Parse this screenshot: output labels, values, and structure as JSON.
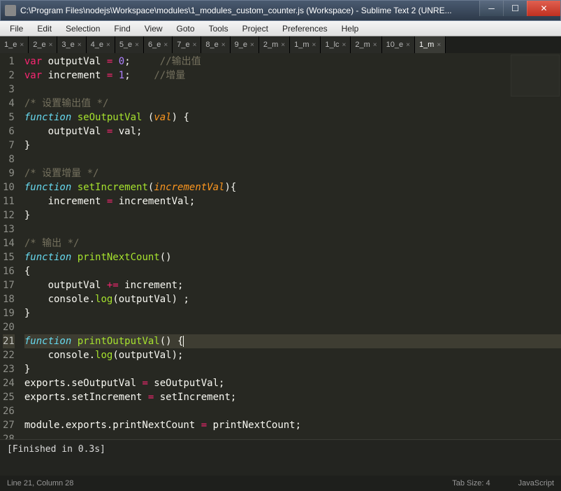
{
  "window": {
    "title": "C:\\Program Files\\nodejs\\Workspace\\modules\\1_modules_custom_counter.js (Workspace) - Sublime Text 2 (UNRE..."
  },
  "menu": [
    "File",
    "Edit",
    "Selection",
    "Find",
    "View",
    "Goto",
    "Tools",
    "Project",
    "Preferences",
    "Help"
  ],
  "tabs": [
    {
      "label": "1_e",
      "active": false
    },
    {
      "label": "2_e",
      "active": false
    },
    {
      "label": "3_e",
      "active": false
    },
    {
      "label": "4_e",
      "active": false
    },
    {
      "label": "5_e",
      "active": false
    },
    {
      "label": "6_e",
      "active": false
    },
    {
      "label": "7_e",
      "active": false
    },
    {
      "label": "8_e",
      "active": false
    },
    {
      "label": "9_e",
      "active": false
    },
    {
      "label": "2_m",
      "active": false
    },
    {
      "label": "1_m",
      "active": false
    },
    {
      "label": "1_lc",
      "active": false
    },
    {
      "label": "2_m",
      "active": false
    },
    {
      "label": "10_e",
      "active": false
    },
    {
      "label": "1_m",
      "active": true
    }
  ],
  "code": [
    {
      "n": 1,
      "tokens": [
        [
          "stor",
          "var"
        ],
        [
          "",
          " "
        ],
        [
          "",
          "outputVal "
        ],
        [
          "op",
          "="
        ],
        [
          "",
          " "
        ],
        [
          "num",
          "0"
        ],
        [
          "",
          ";     "
        ],
        [
          "cmnt",
          "//输出值"
        ]
      ]
    },
    {
      "n": 2,
      "tokens": [
        [
          "stor",
          "var"
        ],
        [
          "",
          " "
        ],
        [
          "",
          "increment "
        ],
        [
          "op",
          "="
        ],
        [
          "",
          " "
        ],
        [
          "num",
          "1"
        ],
        [
          "",
          ";    "
        ],
        [
          "cmnt",
          "//增量"
        ]
      ]
    },
    {
      "n": 3,
      "tokens": []
    },
    {
      "n": 4,
      "tokens": [
        [
          "cmnt",
          "/* 设置输出值 */"
        ]
      ]
    },
    {
      "n": 5,
      "tokens": [
        [
          "kw",
          "function"
        ],
        [
          "",
          " "
        ],
        [
          "name",
          "seOutputVal"
        ],
        [
          "",
          " ("
        ],
        [
          "param",
          "val"
        ],
        [
          "",
          ") {"
        ]
      ]
    },
    {
      "n": 6,
      "tokens": [
        [
          "",
          "    outputVal "
        ],
        [
          "op",
          "="
        ],
        [
          "",
          " val;"
        ]
      ]
    },
    {
      "n": 7,
      "tokens": [
        [
          "",
          "}"
        ]
      ]
    },
    {
      "n": 8,
      "tokens": []
    },
    {
      "n": 9,
      "tokens": [
        [
          "cmnt",
          "/* 设置增量 */"
        ]
      ]
    },
    {
      "n": 10,
      "tokens": [
        [
          "kw",
          "function"
        ],
        [
          "",
          " "
        ],
        [
          "name",
          "setIncrement"
        ],
        [
          "",
          "("
        ],
        [
          "param",
          "incrementVal"
        ],
        [
          "",
          "){"
        ]
      ]
    },
    {
      "n": 11,
      "tokens": [
        [
          "",
          "    increment "
        ],
        [
          "op",
          "="
        ],
        [
          "",
          " incrementVal;"
        ]
      ]
    },
    {
      "n": 12,
      "tokens": [
        [
          "",
          "}"
        ]
      ]
    },
    {
      "n": 13,
      "tokens": []
    },
    {
      "n": 14,
      "tokens": [
        [
          "cmnt",
          "/* 输出 */"
        ]
      ]
    },
    {
      "n": 15,
      "tokens": [
        [
          "kw",
          "function"
        ],
        [
          "",
          " "
        ],
        [
          "name",
          "printNextCount"
        ],
        [
          "",
          "()"
        ]
      ]
    },
    {
      "n": 16,
      "tokens": [
        [
          "",
          "{"
        ]
      ]
    },
    {
      "n": 17,
      "tokens": [
        [
          "",
          "    outputVal "
        ],
        [
          "op",
          "+="
        ],
        [
          "",
          " increment;"
        ]
      ]
    },
    {
      "n": 18,
      "tokens": [
        [
          "",
          "    console."
        ],
        [
          "name",
          "log"
        ],
        [
          "",
          "(outputVal) ;"
        ]
      ]
    },
    {
      "n": 19,
      "tokens": [
        [
          "",
          "}"
        ]
      ]
    },
    {
      "n": 20,
      "tokens": []
    },
    {
      "n": 21,
      "tokens": [
        [
          "kw",
          "function"
        ],
        [
          "",
          " "
        ],
        [
          "name",
          "printOutputVal"
        ],
        [
          "",
          "() {"
        ],
        [
          "cursor",
          ""
        ]
      ],
      "current": true
    },
    {
      "n": 22,
      "tokens": [
        [
          "",
          "    console."
        ],
        [
          "name",
          "log"
        ],
        [
          "",
          "(outputVal);"
        ]
      ]
    },
    {
      "n": 23,
      "tokens": [
        [
          "",
          "}"
        ]
      ]
    },
    {
      "n": 24,
      "tokens": [
        [
          "",
          "exports.seOutputVal "
        ],
        [
          "op",
          "="
        ],
        [
          "",
          " seOutputVal;"
        ]
      ]
    },
    {
      "n": 25,
      "tokens": [
        [
          "",
          "exports.setIncrement "
        ],
        [
          "op",
          "="
        ],
        [
          "",
          " setIncrement;"
        ]
      ]
    },
    {
      "n": 26,
      "tokens": []
    },
    {
      "n": 27,
      "tokens": [
        [
          "",
          "module.exports.printNextCount "
        ],
        [
          "op",
          "="
        ],
        [
          "",
          " printNextCount;"
        ]
      ]
    },
    {
      "n": 28,
      "tokens": []
    }
  ],
  "console": "[Finished in 0.3s]",
  "status": {
    "pos": "Line 21, Column 28",
    "tab": "Tab Size: 4",
    "lang": "JavaScript"
  }
}
